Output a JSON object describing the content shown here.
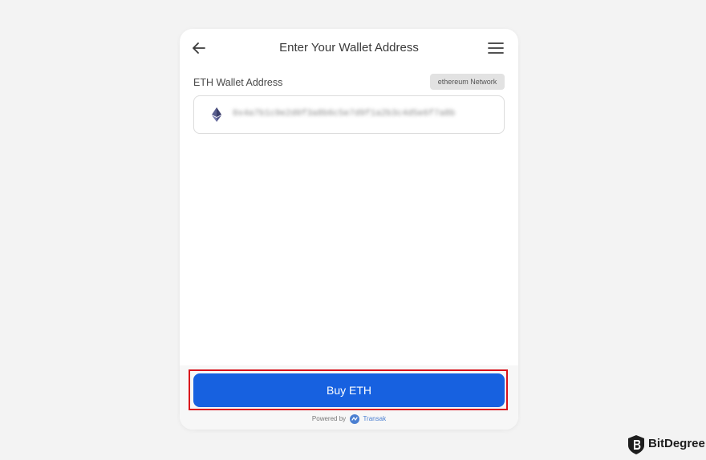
{
  "header": {
    "title": "Enter Your Wallet Address"
  },
  "wallet": {
    "label": "ETH Wallet Address",
    "network_badge": "ethereum Network",
    "address_value": "0x4a7b1c9e2d0f3a8b6c5e7d9f1a2b3c4d5e6f7a8b"
  },
  "actions": {
    "buy_label": "Buy ETH"
  },
  "footer": {
    "powered_by": "Powered by",
    "provider": "Transak"
  },
  "watermark": {
    "brand": "BitDegree"
  },
  "colors": {
    "primary": "#1761e0",
    "highlight": "#d9121b",
    "background": "#f3f3f3"
  }
}
